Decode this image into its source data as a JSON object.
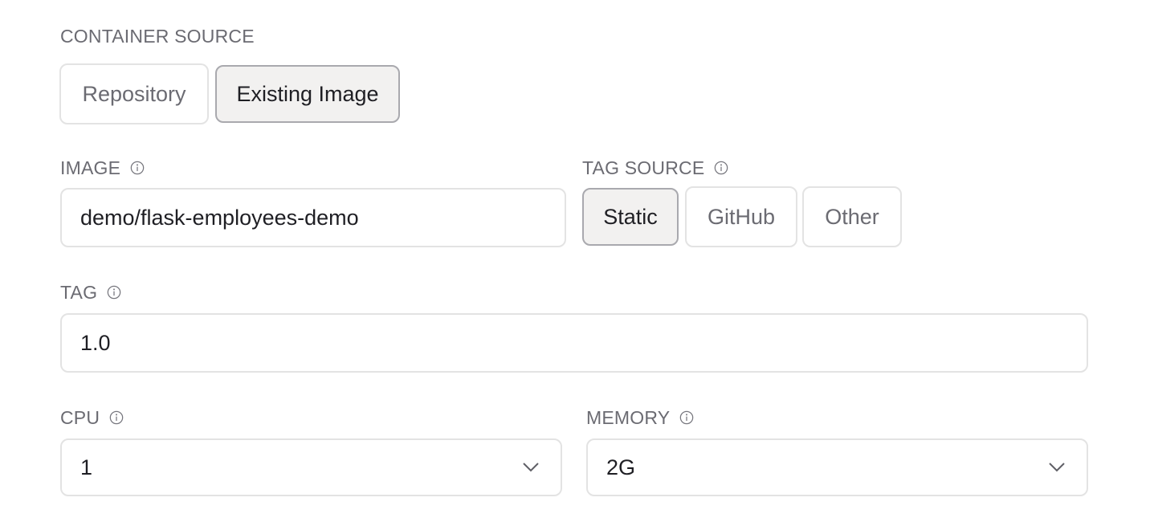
{
  "container_source": {
    "label": "CONTAINER SOURCE",
    "options": [
      {
        "label": "Repository",
        "selected": false
      },
      {
        "label": "Existing Image",
        "selected": true
      }
    ]
  },
  "image": {
    "label": "IMAGE",
    "info_icon": "info-circle-icon",
    "value": "demo/flask-employees-demo"
  },
  "tag_source": {
    "label": "TAG SOURCE",
    "info_icon": "info-circle-icon",
    "options": [
      {
        "label": "Static",
        "selected": true
      },
      {
        "label": "GitHub",
        "selected": false
      },
      {
        "label": "Other",
        "selected": false
      }
    ]
  },
  "tag": {
    "label": "TAG",
    "info_icon": "info-circle-icon",
    "value": "1.0"
  },
  "cpu": {
    "label": "CPU",
    "info_icon": "info-circle-icon",
    "value": "1",
    "dropdown_icon": "chevron-down-icon"
  },
  "memory": {
    "label": "MEMORY",
    "info_icon": "info-circle-icon",
    "value": "2G",
    "dropdown_icon": "chevron-down-icon"
  }
}
